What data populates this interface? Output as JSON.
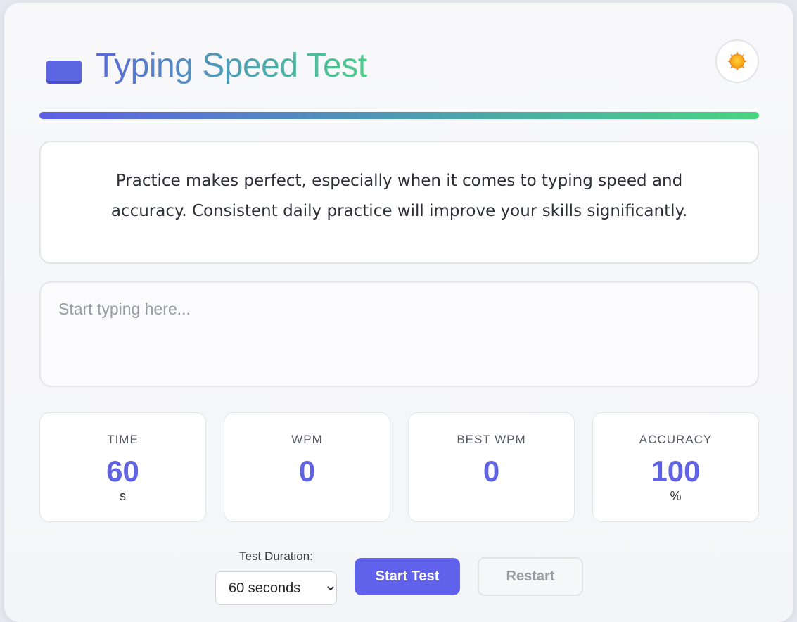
{
  "header": {
    "title": "Typing Speed Test",
    "logo_icon": "keyboard-icon",
    "theme_toggle_icon": "sun-icon"
  },
  "colors": {
    "accent": "#6062ec",
    "gradient_start": "#5d5fe6",
    "gradient_end": "#46d680"
  },
  "text_display": {
    "text": "Practice makes perfect, especially when it comes to typing speed and accuracy. Consistent daily practice will improve your skills significantly."
  },
  "input": {
    "placeholder": "Start typing here...",
    "value": ""
  },
  "stats": [
    {
      "label": "TIME",
      "value": "60",
      "unit": "s"
    },
    {
      "label": "WPM",
      "value": "0",
      "unit": ""
    },
    {
      "label": "BEST WPM",
      "value": "0",
      "unit": ""
    },
    {
      "label": "ACCURACY",
      "value": "100",
      "unit": "%"
    }
  ],
  "controls": {
    "duration_label": "Test Duration:",
    "duration_selected": "60 seconds",
    "start_label": "Start Test",
    "restart_label": "Restart"
  }
}
